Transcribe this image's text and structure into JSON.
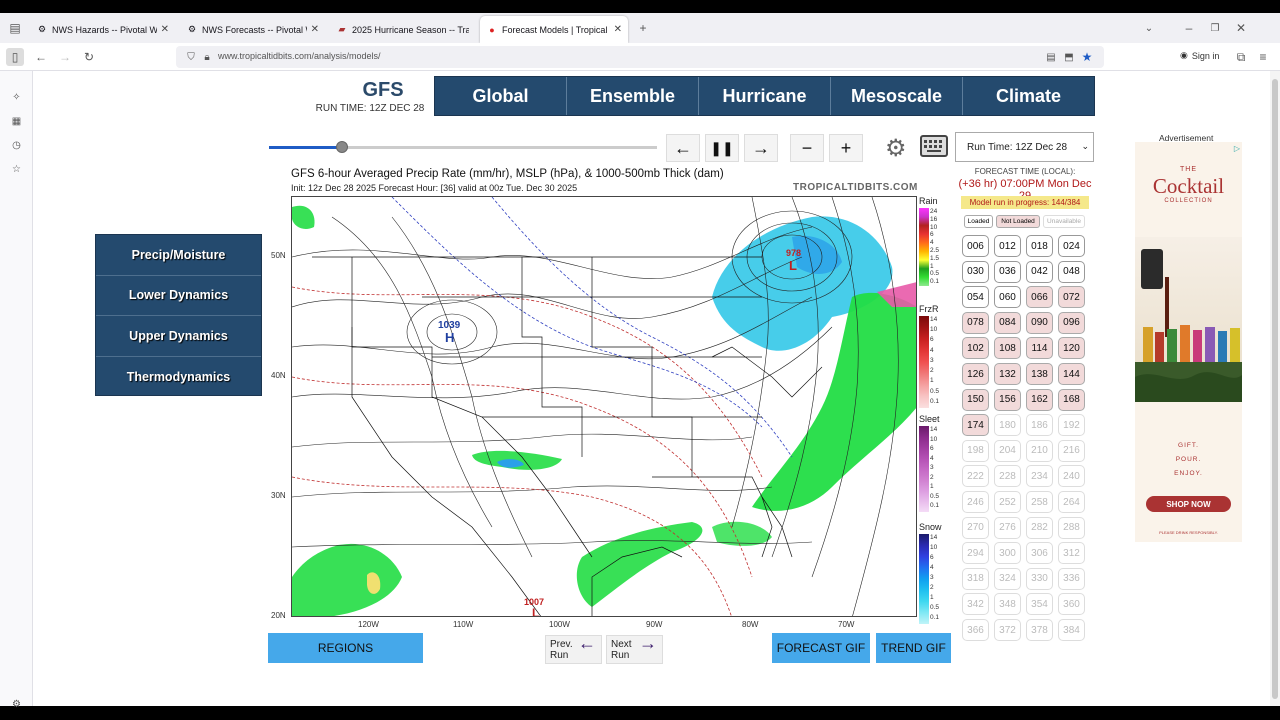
{
  "browser": {
    "tabs": [
      {
        "title": "NWS Hazards -- Pivotal Weath",
        "icon": "gear-favicon"
      },
      {
        "title": "NWS Forecasts -- Pivotal Weat",
        "icon": "gear-favicon"
      },
      {
        "title": "2025 Hurricane Season -- Track",
        "icon": "flag-favicon"
      },
      {
        "title": "Forecast Models | Tropical Tidb",
        "icon": "tropicaltidbits-favicon"
      }
    ],
    "url": "www.tropicaltidbits.com/analysis/models/",
    "sign_in": "Sign in"
  },
  "header": {
    "model": "GFS",
    "run_time": "RUN TIME: 12Z DEC 28",
    "nav": [
      "Global",
      "Ensemble",
      "Hurricane",
      "Mesoscale",
      "Climate"
    ]
  },
  "controls": {
    "run_select": "Run Time: 12Z Dec 28"
  },
  "left_menu": [
    "Precip/Moisture",
    "Lower Dynamics",
    "Upper Dynamics",
    "Thermodynamics"
  ],
  "map": {
    "title": "GFS 6-hour Averaged Precip Rate (mm/hr), MSLP (hPa), & 1000-500mb Thick (dam)",
    "init": "Init: 12z Dec 28 2025   Forecast Hour: [36]   valid at 00z Tue. Dec 30 2025",
    "watermark": "TROPICALTIDBITS.COM",
    "lat_labels": [
      "50N",
      "40N",
      "30N",
      "20N"
    ],
    "lon_labels": [
      "120W",
      "110W",
      "100W",
      "90W",
      "80W",
      "70W"
    ],
    "pressure_labels": {
      "high": "1039",
      "low_ne": "978",
      "low_mx": "1007"
    }
  },
  "legend": {
    "sections": [
      {
        "title": "Rain",
        "ticks": [
          "24",
          "16",
          "10",
          "6",
          "4",
          "2.5",
          "1.5",
          "1",
          "0.5",
          "0.1"
        ]
      },
      {
        "title": "FrzR",
        "ticks": [
          "14",
          "10",
          "6",
          "4",
          "3",
          "2",
          "1",
          "0.5",
          "0.1"
        ]
      },
      {
        "title": "Sleet",
        "ticks": [
          "14",
          "10",
          "6",
          "4",
          "3",
          "2",
          "1",
          "0.5",
          "0.1"
        ]
      },
      {
        "title": "Snow",
        "ticks": [
          "14",
          "10",
          "6",
          "4",
          "3",
          "2",
          "1",
          "0.5",
          "0.1"
        ]
      }
    ]
  },
  "buttons": {
    "regions": "REGIONS",
    "prev_run": "Prev.\nRun",
    "next_run": "Next\nRun",
    "forecast_gif": "FORECAST GIF",
    "trend_gif": "TREND GIF"
  },
  "forecast": {
    "label": "FORECAST TIME (LOCAL):",
    "time": "(+36 hr) 07:00PM Mon Dec 29",
    "progress": "Model run in progress: 144/384",
    "keys": [
      "Loaded",
      "Not Loaded",
      "Unavailable"
    ],
    "hours_loaded": [
      "006",
      "012",
      "018",
      "024",
      "030",
      "036",
      "042",
      "048",
      "054",
      "060"
    ],
    "hours_notloaded": [
      "066",
      "072",
      "078",
      "084",
      "090",
      "096",
      "102",
      "108",
      "114",
      "120",
      "126",
      "132",
      "138",
      "144",
      "150",
      "156",
      "162",
      "168",
      "174"
    ],
    "hours_unavailable": [
      "180",
      "186",
      "192",
      "198",
      "204",
      "210",
      "216",
      "222",
      "228",
      "234",
      "240",
      "246",
      "252",
      "258",
      "264",
      "270",
      "276",
      "282",
      "288",
      "294",
      "300",
      "306",
      "312",
      "318",
      "324",
      "330",
      "336",
      "342",
      "348",
      "354",
      "360",
      "366",
      "372",
      "378",
      "384"
    ]
  },
  "ad": {
    "label": "Advertisement",
    "brand_small": "THE",
    "brand": "Cocktail",
    "brand_sub": "COLLECTION",
    "lines": [
      "GIFT.",
      "POUR.",
      "ENJOY."
    ],
    "cta": "SHOP NOW",
    "fine": "PLEASE DRINK RESPONSIBLY."
  },
  "colors": {
    "nav_bg": "#244a6e",
    "button_blue": "#45a8ea",
    "precip_green": "#22dd44",
    "precip_cyan": "#33c8e8",
    "not_loaded": "#f2dada"
  }
}
